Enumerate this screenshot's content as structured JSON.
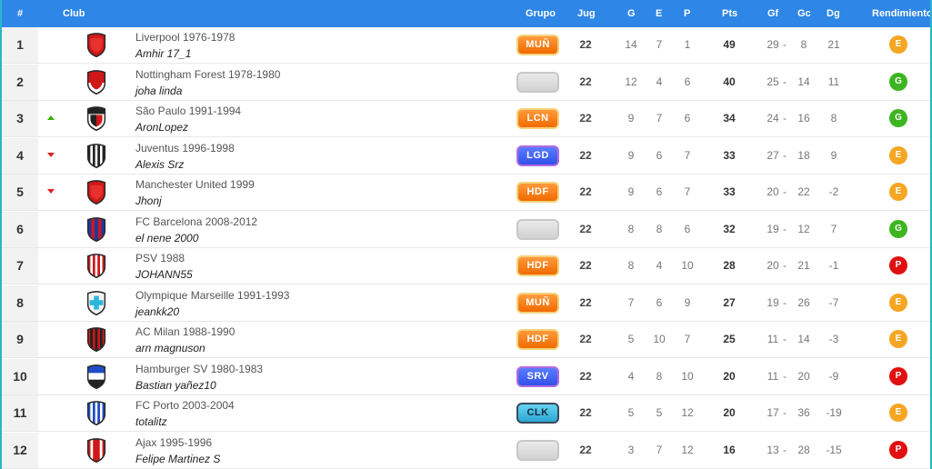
{
  "header": {
    "pos": "#",
    "club": "Club",
    "grupo": "Grupo",
    "jug": "Jug",
    "g": "G",
    "e": "E",
    "p": "P",
    "pts": "Pts",
    "gf": "Gf",
    "gc": "Gc",
    "dg": "Dg",
    "rendimiento": "Rendimiento"
  },
  "colors": {
    "header_bg": "#2e86e6",
    "border": "#29b6c8",
    "rend_E": "#f5a623",
    "rend_G": "#3cb521",
    "rend_P": "#e01010"
  },
  "rows": [
    {
      "pos": "1",
      "trend": "none",
      "club": "Liverpool 1976-1978",
      "manager": "Amhir 17_1",
      "crest": "solid-red-shield-icon",
      "group": "MUÑ",
      "group_style": "orange",
      "jug": "22",
      "g": "14",
      "e": "7",
      "p": "1",
      "pts": "49",
      "gf": "29",
      "sep": "-",
      "gc": "8",
      "dg": "21",
      "rend": "E"
    },
    {
      "pos": "2",
      "trend": "none",
      "club": "Nottingham Forest 1978-1980",
      "manager": "joha linda",
      "crest": "red-white-half-shield-icon",
      "group": "",
      "group_style": "empty",
      "jug": "22",
      "g": "12",
      "e": "4",
      "p": "6",
      "pts": "40",
      "gf": "25",
      "sep": "-",
      "gc": "14",
      "dg": "11",
      "rend": "G"
    },
    {
      "pos": "3",
      "trend": "up",
      "club": "São Paulo 1991-1994",
      "manager": "AronLopez",
      "crest": "sao-paulo-shield-icon",
      "group": "LCN",
      "group_style": "orange",
      "jug": "22",
      "g": "9",
      "e": "7",
      "p": "6",
      "pts": "34",
      "gf": "24",
      "sep": "-",
      "gc": "16",
      "dg": "8",
      "rend": "G"
    },
    {
      "pos": "4",
      "trend": "down",
      "club": "Juventus 1996-1998",
      "manager": "Alexis Srz",
      "crest": "black-white-stripes-shield-icon",
      "group": "LGD",
      "group_style": "purple",
      "jug": "22",
      "g": "9",
      "e": "6",
      "p": "7",
      "pts": "33",
      "gf": "27",
      "sep": "-",
      "gc": "18",
      "dg": "9",
      "rend": "E"
    },
    {
      "pos": "5",
      "trend": "down",
      "club": "Manchester United 1999",
      "manager": "Jhonj",
      "crest": "solid-red-shield-icon",
      "group": "HDF",
      "group_style": "orange",
      "jug": "22",
      "g": "9",
      "e": "6",
      "p": "7",
      "pts": "33",
      "gf": "20",
      "sep": "-",
      "gc": "22",
      "dg": "-2",
      "rend": "E"
    },
    {
      "pos": "6",
      "trend": "none",
      "club": "FC Barcelona 2008-2012",
      "manager": "el nene 2000",
      "crest": "blue-red-stripes-shield-icon",
      "group": "",
      "group_style": "empty",
      "jug": "22",
      "g": "8",
      "e": "8",
      "p": "6",
      "pts": "32",
      "gf": "19",
      "sep": "-",
      "gc": "12",
      "dg": "7",
      "rend": "G"
    },
    {
      "pos": "7",
      "trend": "none",
      "club": "PSV 1988",
      "manager": "JOHANN55",
      "crest": "red-white-stripes-shield-icon",
      "group": "HDF",
      "group_style": "orange",
      "jug": "22",
      "g": "8",
      "e": "4",
      "p": "10",
      "pts": "28",
      "gf": "20",
      "sep": "-",
      "gc": "21",
      "dg": "-1",
      "rend": "P"
    },
    {
      "pos": "8",
      "trend": "none",
      "club": "Olympique Marseille 1991-1993",
      "manager": "jeankk20",
      "crest": "white-cyan-cross-shield-icon",
      "group": "MUÑ",
      "group_style": "orange",
      "jug": "22",
      "g": "7",
      "e": "6",
      "p": "9",
      "pts": "27",
      "gf": "19",
      "sep": "-",
      "gc": "26",
      "dg": "-7",
      "rend": "E"
    },
    {
      "pos": "9",
      "trend": "none",
      "club": "AC Milan 1988-1990",
      "manager": "arn magnuson",
      "crest": "red-black-stripes-shield-icon",
      "group": "HDF",
      "group_style": "orange",
      "jug": "22",
      "g": "5",
      "e": "10",
      "p": "7",
      "pts": "25",
      "gf": "11",
      "sep": "-",
      "gc": "14",
      "dg": "-3",
      "rend": "E"
    },
    {
      "pos": "10",
      "trend": "none",
      "club": "Hamburger SV 1980-1983",
      "manager": "Bastian yañez10",
      "crest": "blue-white-black-band-shield-icon",
      "group": "SRV",
      "group_style": "purple",
      "jug": "22",
      "g": "4",
      "e": "8",
      "p": "10",
      "pts": "20",
      "gf": "11",
      "sep": "-",
      "gc": "20",
      "dg": "-9",
      "rend": "P"
    },
    {
      "pos": "11",
      "trend": "none",
      "club": "FC Porto 2003-2004",
      "manager": "totalitz",
      "crest": "blue-white-stripes-shield-icon",
      "group": "CLK",
      "group_style": "cyan",
      "jug": "22",
      "g": "5",
      "e": "5",
      "p": "12",
      "pts": "20",
      "gf": "17",
      "sep": "-",
      "gc": "36",
      "dg": "-19",
      "rend": "E"
    },
    {
      "pos": "12",
      "trend": "none",
      "club": "Ajax 1995-1996",
      "manager": "Felipe Martinez S",
      "crest": "red-white-center-shield-icon",
      "group": "",
      "group_style": "empty",
      "jug": "22",
      "g": "3",
      "e": "7",
      "p": "12",
      "pts": "16",
      "gf": "13",
      "sep": "-",
      "gc": "28",
      "dg": "-15",
      "rend": "P"
    }
  ]
}
